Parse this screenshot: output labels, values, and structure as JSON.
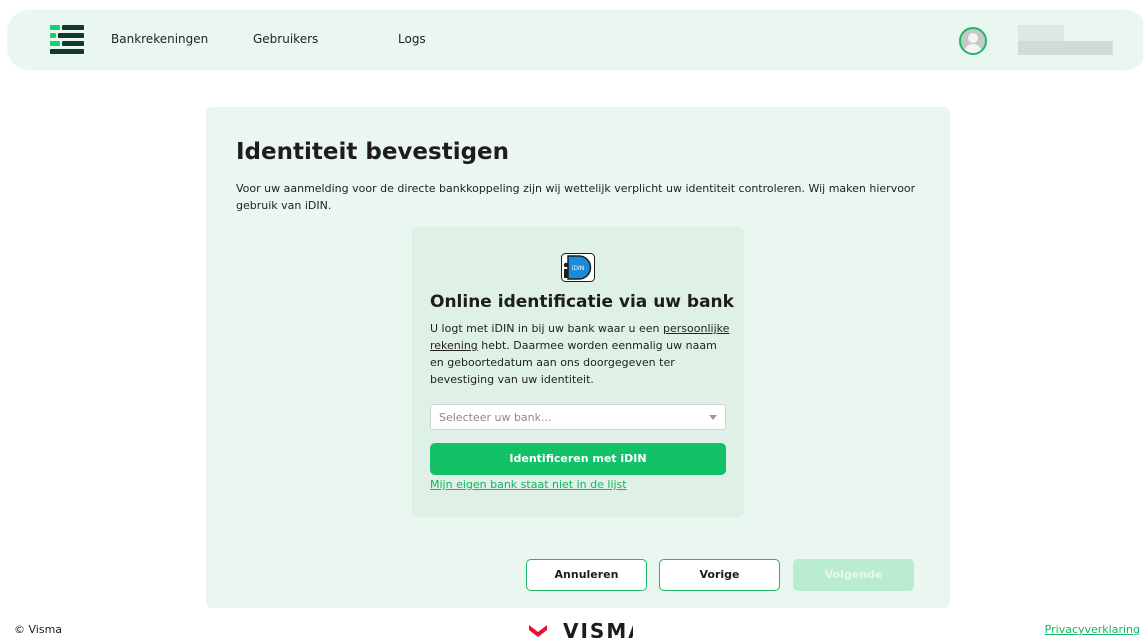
{
  "nav": {
    "items": [
      {
        "label": "Bankrekeningen"
      },
      {
        "label": "Gebruikers"
      },
      {
        "label": "Logs"
      }
    ]
  },
  "page": {
    "title": "Identiteit bevestigen",
    "intro": "Voor uw aanmelding voor de directe bankkoppeling zijn wij wettelijk verplicht uw identiteit controleren. Wij maken hiervoor gebruik van iDIN."
  },
  "idin": {
    "icon_label": "iDIN",
    "title": "Online identificatie via uw bank",
    "text_before": "U logt met iDIN in bij uw bank waar u een ",
    "text_link": "persoonlijke rekening",
    "text_after": " hebt. Daarmee worden eenmalig uw naam en geboortedatum aan ons doorgegeven ter bevestiging van uw identiteit.",
    "select_placeholder": "Selecteer uw bank...",
    "button_label": "Identificeren met iDIN",
    "bank_missing_link": "Mijn eigen bank staat niet in de lijst"
  },
  "actions": {
    "cancel": "Annuleren",
    "previous": "Vorige",
    "next": "Volgende"
  },
  "footer": {
    "copyright": "© Visma",
    "brand": "VISMA",
    "privacy": "Privacyverklaring"
  },
  "colors": {
    "accent": "#12c168",
    "background_tint": "#eaf6f0"
  }
}
